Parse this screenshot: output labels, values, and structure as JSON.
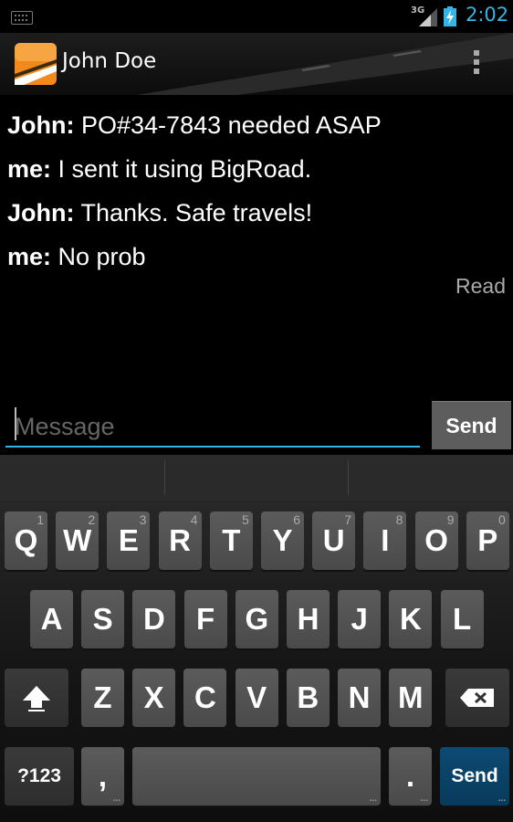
{
  "status": {
    "network": "3G",
    "time": "2:02"
  },
  "header": {
    "title": "John Doe"
  },
  "messages": [
    {
      "sender": "John:",
      "text": " PO#34-7843 needed ASAP"
    },
    {
      "sender": "me:",
      "text": " I sent it using BigRoad."
    },
    {
      "sender": "John:",
      "text": " Thanks. Safe travels!"
    },
    {
      "sender": "me:",
      "text": " No prob"
    }
  ],
  "read_status": "Read",
  "compose": {
    "placeholder": "Message",
    "send_label": "Send"
  },
  "keyboard": {
    "row1": [
      {
        "l": "Q",
        "n": "1"
      },
      {
        "l": "W",
        "n": "2"
      },
      {
        "l": "E",
        "n": "3"
      },
      {
        "l": "R",
        "n": "4"
      },
      {
        "l": "T",
        "n": "5"
      },
      {
        "l": "Y",
        "n": "6"
      },
      {
        "l": "U",
        "n": "7"
      },
      {
        "l": "I",
        "n": "8"
      },
      {
        "l": "O",
        "n": "9"
      },
      {
        "l": "P",
        "n": "0"
      }
    ],
    "row2": [
      "A",
      "S",
      "D",
      "F",
      "G",
      "H",
      "J",
      "K",
      "L"
    ],
    "row3": [
      "Z",
      "X",
      "C",
      "V",
      "B",
      "N",
      "M"
    ],
    "symbols_label": "?123",
    "comma": ",",
    "period": ".",
    "action_label": "Send"
  },
  "colors": {
    "accent": "#33b5e5",
    "logo": "#f08a1c",
    "action_key": "#0d4a73"
  }
}
